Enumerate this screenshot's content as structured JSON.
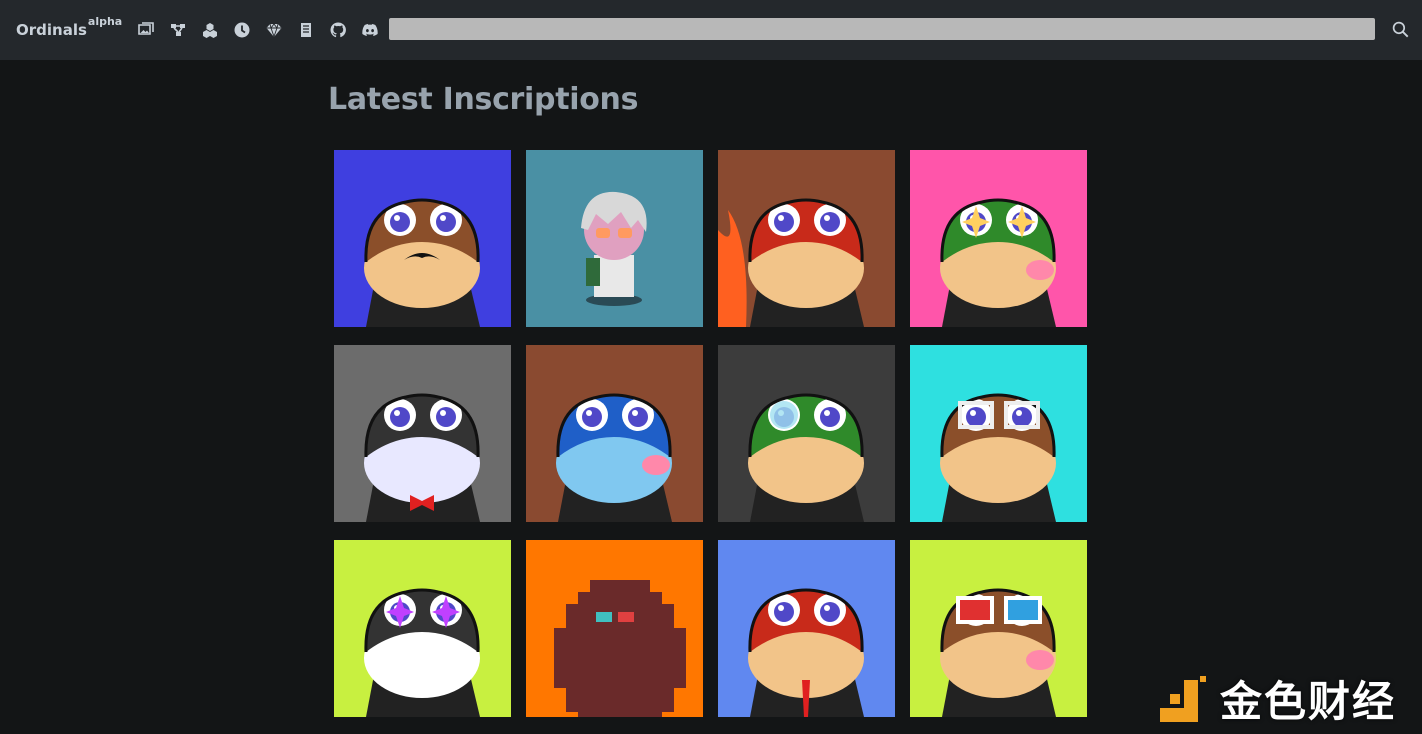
{
  "nav": {
    "brand": "Ordinals",
    "brand_sup": "alpha",
    "icons": [
      "gallery-icon",
      "nodes-icon",
      "blocks-icon",
      "clock-icon",
      "diamond-icon",
      "book-icon",
      "github-icon",
      "discord-icon"
    ],
    "search": {
      "value": "",
      "placeholder": ""
    },
    "search_button_icon": "magnifier-icon"
  },
  "main": {
    "title": "Latest Inscriptions",
    "inscriptions": [
      {
        "bg": "#3f3fe0",
        "kind": "frog",
        "skin": "#8b4f2a",
        "belly": "#f2c489",
        "feature": "mustache"
      },
      {
        "bg": "#4a90a4",
        "kind": "chibi",
        "skin": "#e0a0c0",
        "belly": "#ffffff",
        "feature": "goggles"
      },
      {
        "bg": "#8a4a30",
        "kind": "frog",
        "skin": "#c82a1a",
        "belly": "#f2c489",
        "feature": "flame"
      },
      {
        "bg": "#ff55aa",
        "kind": "frog",
        "skin": "#2f8a2a",
        "belly": "#f2c489",
        "feature": "sparkle"
      },
      {
        "bg": "#6c6c6c",
        "kind": "frog",
        "skin": "#333333",
        "belly": "#e8e8ff",
        "feature": "bowtie"
      },
      {
        "bg": "#8a4a30",
        "kind": "frog",
        "skin": "#1f5fc8",
        "belly": "#80c8f0",
        "feature": "wide-eyes"
      },
      {
        "bg": "#3c3c3c",
        "kind": "frog",
        "skin": "#2f8a2a",
        "belly": "#f2c489",
        "feature": "monocle"
      },
      {
        "bg": "#2ee0e0",
        "kind": "frog",
        "skin": "#8b4f2a",
        "belly": "#f2c489",
        "feature": "glasses"
      },
      {
        "bg": "#c8f040",
        "kind": "frog",
        "skin": "#333333",
        "belly": "#ffffff",
        "feature": "purple-sparkle"
      },
      {
        "bg": "#ff7700",
        "kind": "pixelated",
        "skin": "#b06050",
        "belly": "#f0c8a0",
        "feature": "3d-glasses"
      },
      {
        "bg": "#6088f0",
        "kind": "frog",
        "skin": "#c82a1a",
        "belly": "#f2c489",
        "feature": "suit"
      },
      {
        "bg": "#c8f040",
        "kind": "frog",
        "skin": "#8b4f2a",
        "belly": "#f2c489",
        "feature": "3d-glasses"
      }
    ]
  },
  "watermark": {
    "text": "金色财经",
    "color": "#f0a020"
  }
}
